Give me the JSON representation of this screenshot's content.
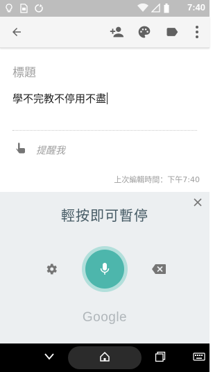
{
  "status_bar": {
    "time": "7:40",
    "icons": [
      "bulb-icon",
      "sim-card-icon",
      "sync-icon",
      "wifi-icon",
      "signal-icon",
      "battery-icon"
    ]
  },
  "app_bar": {
    "icons": [
      "back-arrow-icon",
      "add-collaborator-icon",
      "palette-icon",
      "label-icon",
      "more-vert-icon"
    ]
  },
  "note": {
    "title_placeholder": "標題",
    "body": "學不完教不停用不盡",
    "reminder_text": "提醒我",
    "last_edited": "上次編輯時間：下午7:40"
  },
  "voice": {
    "prompt": "輕按即可暫停",
    "brand": "Google",
    "accent_color": "#4db6ac",
    "panel_color": "#eceff1"
  },
  "nav_bar": {
    "icons": [
      "back-icon",
      "home-icon",
      "recents-icon",
      "keyboard-icon"
    ]
  }
}
